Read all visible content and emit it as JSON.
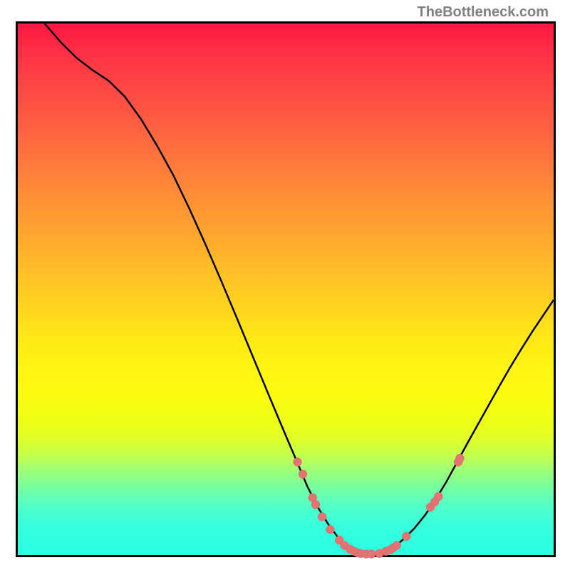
{
  "watermark": "TheBottleneck.com",
  "chart_data": {
    "type": "line",
    "title": "",
    "xlabel": "",
    "ylabel": "",
    "xlim": [
      0,
      100
    ],
    "ylim": [
      0,
      100
    ],
    "curve": [
      {
        "x": 5.0,
        "y": 100.0
      },
      {
        "x": 8.0,
        "y": 96.5
      },
      {
        "x": 11.0,
        "y": 93.5
      },
      {
        "x": 14.0,
        "y": 91.2
      },
      {
        "x": 17.0,
        "y": 89.2
      },
      {
        "x": 20.0,
        "y": 86.2
      },
      {
        "x": 23.0,
        "y": 82.0
      },
      {
        "x": 26.0,
        "y": 77.0
      },
      {
        "x": 29.0,
        "y": 71.5
      },
      {
        "x": 32.0,
        "y": 65.2
      },
      {
        "x": 35.0,
        "y": 58.5
      },
      {
        "x": 38.0,
        "y": 51.5
      },
      {
        "x": 41.0,
        "y": 44.3
      },
      {
        "x": 44.0,
        "y": 37.0
      },
      {
        "x": 47.0,
        "y": 29.7
      },
      {
        "x": 50.0,
        "y": 22.5
      },
      {
        "x": 52.0,
        "y": 17.8
      },
      {
        "x": 54.0,
        "y": 13.0
      },
      {
        "x": 56.0,
        "y": 9.0
      },
      {
        "x": 58.0,
        "y": 5.7
      },
      {
        "x": 60.0,
        "y": 3.0
      },
      {
        "x": 61.5,
        "y": 1.6
      },
      {
        "x": 63.0,
        "y": 0.7
      },
      {
        "x": 64.5,
        "y": 0.2
      },
      {
        "x": 66.0,
        "y": 0.0
      },
      {
        "x": 67.5,
        "y": 0.2
      },
      {
        "x": 69.0,
        "y": 0.8
      },
      {
        "x": 70.5,
        "y": 1.7
      },
      {
        "x": 72.0,
        "y": 3.0
      },
      {
        "x": 74.0,
        "y": 5.0
      },
      {
        "x": 76.0,
        "y": 7.5
      },
      {
        "x": 78.0,
        "y": 10.5
      },
      {
        "x": 80.0,
        "y": 13.8
      },
      {
        "x": 82.0,
        "y": 17.5
      },
      {
        "x": 84.0,
        "y": 21.2
      },
      {
        "x": 86.0,
        "y": 24.8
      },
      {
        "x": 88.0,
        "y": 28.4
      },
      {
        "x": 90.0,
        "y": 32.0
      },
      {
        "x": 92.0,
        "y": 35.5
      },
      {
        "x": 94.0,
        "y": 38.8
      },
      {
        "x": 96.0,
        "y": 42.0
      },
      {
        "x": 98.0,
        "y": 45.0
      },
      {
        "x": 100.0,
        "y": 48.0
      }
    ],
    "dots": [
      {
        "x": 52.2,
        "y": 17.5
      },
      {
        "x": 53.2,
        "y": 15.2
      },
      {
        "x": 55.0,
        "y": 10.8
      },
      {
        "x": 55.6,
        "y": 9.5
      },
      {
        "x": 56.8,
        "y": 7.2
      },
      {
        "x": 58.3,
        "y": 4.8
      },
      {
        "x": 60.0,
        "y": 2.8
      },
      {
        "x": 61.0,
        "y": 1.8
      },
      {
        "x": 62.0,
        "y": 1.1
      },
      {
        "x": 62.8,
        "y": 0.7
      },
      {
        "x": 63.5,
        "y": 0.4
      },
      {
        "x": 64.0,
        "y": 0.3
      },
      {
        "x": 65.0,
        "y": 0.2
      },
      {
        "x": 66.0,
        "y": 0.2
      },
      {
        "x": 67.5,
        "y": 0.3
      },
      {
        "x": 68.7,
        "y": 0.7
      },
      {
        "x": 69.5,
        "y": 1.0
      },
      {
        "x": 70.0,
        "y": 1.3
      },
      {
        "x": 70.7,
        "y": 1.8
      },
      {
        "x": 72.5,
        "y": 3.5
      },
      {
        "x": 77.0,
        "y": 9.0
      },
      {
        "x": 77.8,
        "y": 10.0
      },
      {
        "x": 78.5,
        "y": 11.0
      },
      {
        "x": 82.2,
        "y": 17.5
      },
      {
        "x": 82.5,
        "y": 18.2
      }
    ],
    "dot_radius": 6,
    "colors": {
      "curve": "#000000",
      "dots_fill": "#e57373",
      "gradient_top": "#ff1744",
      "gradient_bottom": "#2bffe2"
    }
  }
}
